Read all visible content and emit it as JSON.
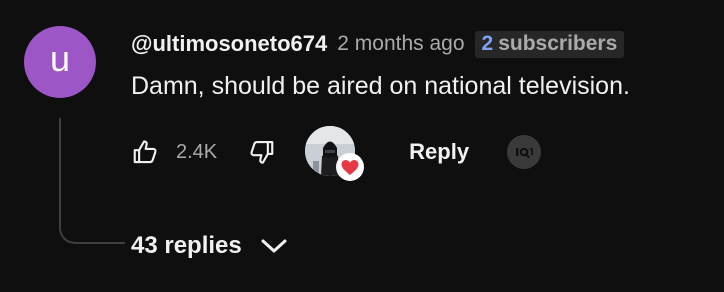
{
  "comment": {
    "avatar_letter": "u",
    "avatar_color": "#9c56c6",
    "author": "@ultimosoneto674",
    "timestamp": "2 months ago",
    "badge": {
      "count": "2",
      "label": "subscribers",
      "count_color": "#7ea3f2"
    },
    "text": "Damn, should be aired on national television."
  },
  "actions": {
    "like_icon": "thumbs-up-icon",
    "like_count": "2.4K",
    "dislike_icon": "thumbs-down-icon",
    "creator_heart_icon": "heart-icon",
    "heart_color": "#e53945",
    "reply_label": "Reply",
    "translate_icon": "translate-icon"
  },
  "replies": {
    "label": "43 replies",
    "icon": "chevron-down-icon"
  }
}
